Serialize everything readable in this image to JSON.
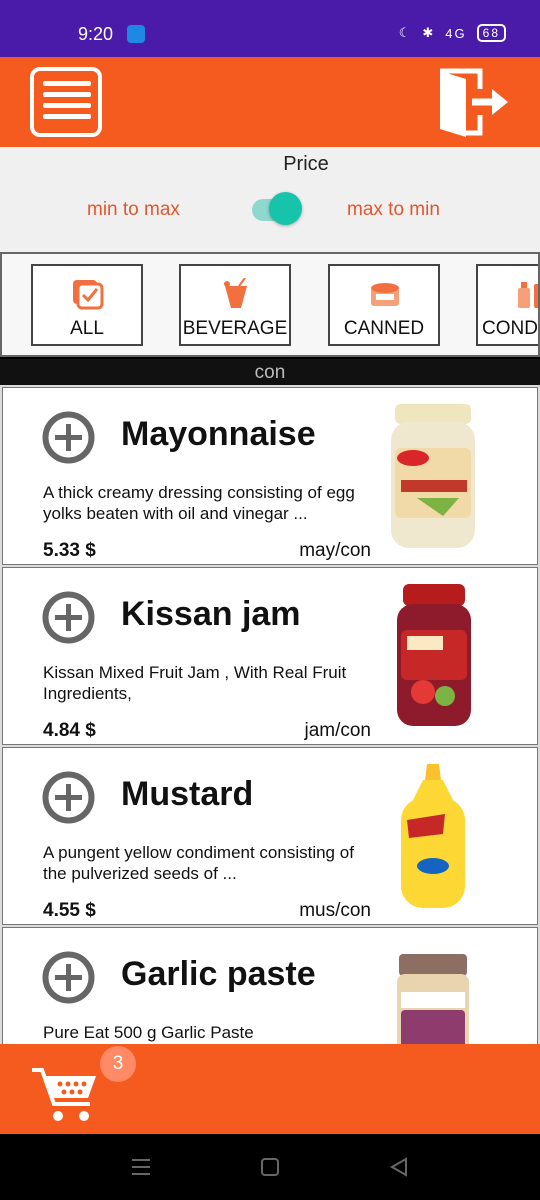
{
  "status_bar": {
    "time": "9:20",
    "network": "4G",
    "battery": "68"
  },
  "sort": {
    "title": "Price",
    "option_left": "min to max",
    "option_right": "max to min",
    "toggle_on": true
  },
  "categories": [
    {
      "label": "ALL",
      "icon": "check-box-icon"
    },
    {
      "label": "BEVERAGE",
      "icon": "drink-glass-icon"
    },
    {
      "label": "CANNED",
      "icon": "canned-food-icon"
    },
    {
      "label": "CONDIMENTS",
      "icon": "condiment-bottles-icon"
    }
  ],
  "filter": {
    "text": "con"
  },
  "products": [
    {
      "name": "Mayonnaise",
      "description": "A thick creamy dressing consisting of egg yolks beaten with oil and vinegar ...",
      "price": "5.33  $",
      "code": "may/con",
      "image": "mayonnaise-jar"
    },
    {
      "name": "Kissan jam",
      "description": "Kissan Mixed Fruit Jam , With Real Fruit Ingredients,",
      "price": "4.84  $",
      "code": "jam/con",
      "image": "jam-jar"
    },
    {
      "name": "Mustard",
      "description": "A pungent yellow condiment consisting of the pulverized seeds of ...",
      "price": "4.55  $",
      "code": "mus/con",
      "image": "mustard-bottle"
    },
    {
      "name": "Garlic paste",
      "description": "Pure Eat 500 g Garlic Paste",
      "price": "",
      "code": "",
      "image": "garlic-paste-jar"
    }
  ],
  "cart": {
    "count": "3"
  },
  "colors": {
    "primary": "#f55a1e",
    "accent": "#17c3aa",
    "sort_text": "#e4572e",
    "status_bar": "#4a1aa8"
  }
}
